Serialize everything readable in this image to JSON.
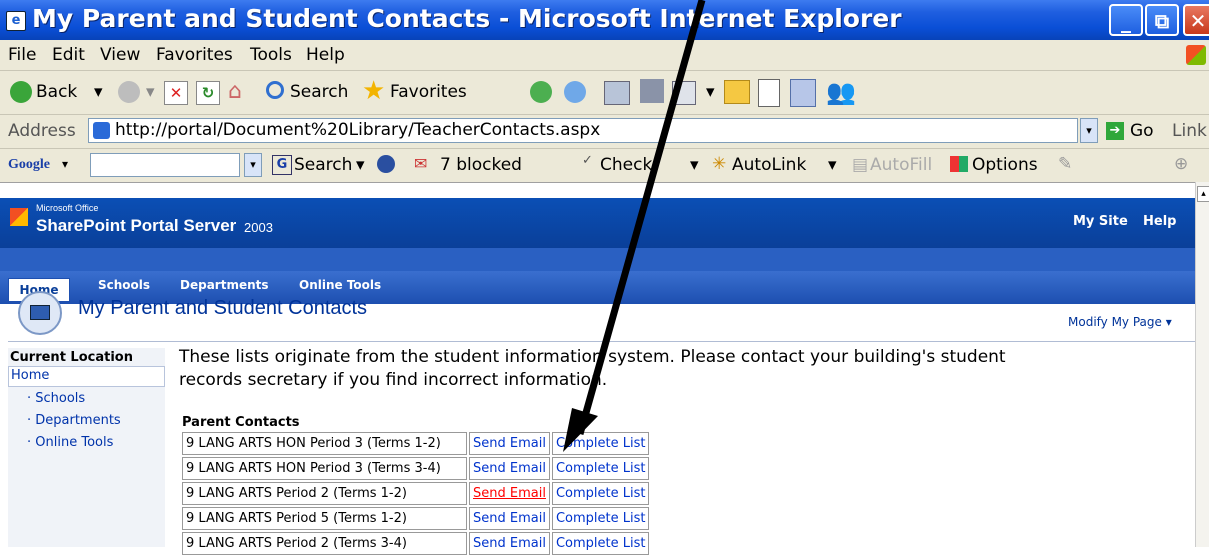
{
  "window": {
    "title": "My Parent and Student Contacts - Microsoft Internet Explorer",
    "min_label": "_",
    "max_label": "⧉",
    "close_label": "✕"
  },
  "menu": [
    "File",
    "Edit",
    "View",
    "Favorites",
    "Tools",
    "Help"
  ],
  "toolbar": {
    "back": "Back",
    "search": "Search",
    "favorites": "Favorites"
  },
  "address": {
    "label": "Address",
    "url": "http://portal/Document%20Library/TeacherContacts.aspx",
    "go": "Go",
    "links": "Link"
  },
  "googlebar": {
    "logo": "Google",
    "search": "Search",
    "blocked": "7 blocked",
    "check": "Check",
    "autolink": "AutoLink",
    "autofill": "AutoFill",
    "options": "Options"
  },
  "sharepoint": {
    "ms_office": "Microsoft Office",
    "product": "SharePoint Portal Server",
    "version": "2003",
    "my_site": "My Site",
    "help": "Help",
    "nav": [
      "Home",
      "Schools",
      "Departments",
      "Online Tools"
    ],
    "page_title": "My Parent and Student Contacts",
    "modify": "Modify My Page"
  },
  "sidebar": {
    "heading": "Current Location",
    "home": "Home",
    "links": [
      "Schools",
      "Departments",
      "Online Tools"
    ]
  },
  "main": {
    "intro_line1": "These lists originate from the student information system.  Please contact your building's student",
    "intro_line2": "records secretary if you find incorrect information.",
    "section_title": "Parent Contacts",
    "rows": [
      {
        "course": "9 LANG ARTS HON Period 3 (Terms 1-2)",
        "email": "Send Email",
        "list": "Complete List"
      },
      {
        "course": "9 LANG ARTS HON Period 3 (Terms 3-4)",
        "email": "Send Email",
        "list": "Complete List"
      },
      {
        "course": "9 LANG ARTS Period 2 (Terms 1-2)",
        "email": "Send Email",
        "list": "Complete List"
      },
      {
        "course": "9 LANG ARTS Period 5 (Terms 1-2)",
        "email": "Send Email",
        "list": "Complete List"
      },
      {
        "course": "9 LANG ARTS Period 2 (Terms 3-4)",
        "email": "Send Email",
        "list": "Complete List"
      }
    ]
  }
}
